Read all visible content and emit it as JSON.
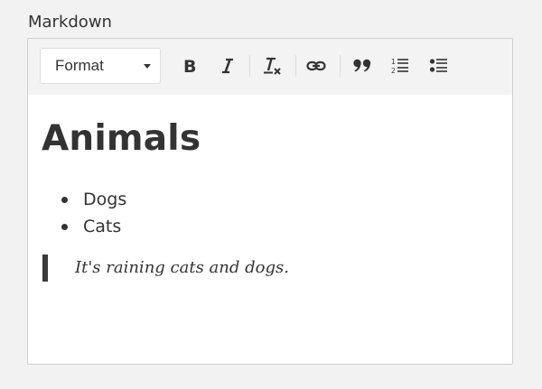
{
  "field": {
    "label": "Markdown"
  },
  "toolbar": {
    "format_select": {
      "value": "Format"
    },
    "buttons": [
      {
        "name": "bold",
        "icon": "bold-icon"
      },
      {
        "name": "italic",
        "icon": "italic-icon"
      },
      {
        "name": "clear-format",
        "icon": "clear-format-icon"
      },
      {
        "name": "link",
        "icon": "link-icon"
      },
      {
        "name": "blockquote",
        "icon": "quote-icon"
      },
      {
        "name": "ordered-list",
        "icon": "ordered-list-icon"
      },
      {
        "name": "bullet-list",
        "icon": "bullet-list-icon"
      }
    ]
  },
  "document": {
    "heading": "Animals",
    "list_items": [
      "Dogs",
      "Cats"
    ],
    "blockquote": "It's raining cats and dogs."
  },
  "colors": {
    "text": "#333333",
    "toolbar_bg": "#f3f3f3",
    "border": "#cfcfcf",
    "page_bg": "#f2f2f2"
  }
}
